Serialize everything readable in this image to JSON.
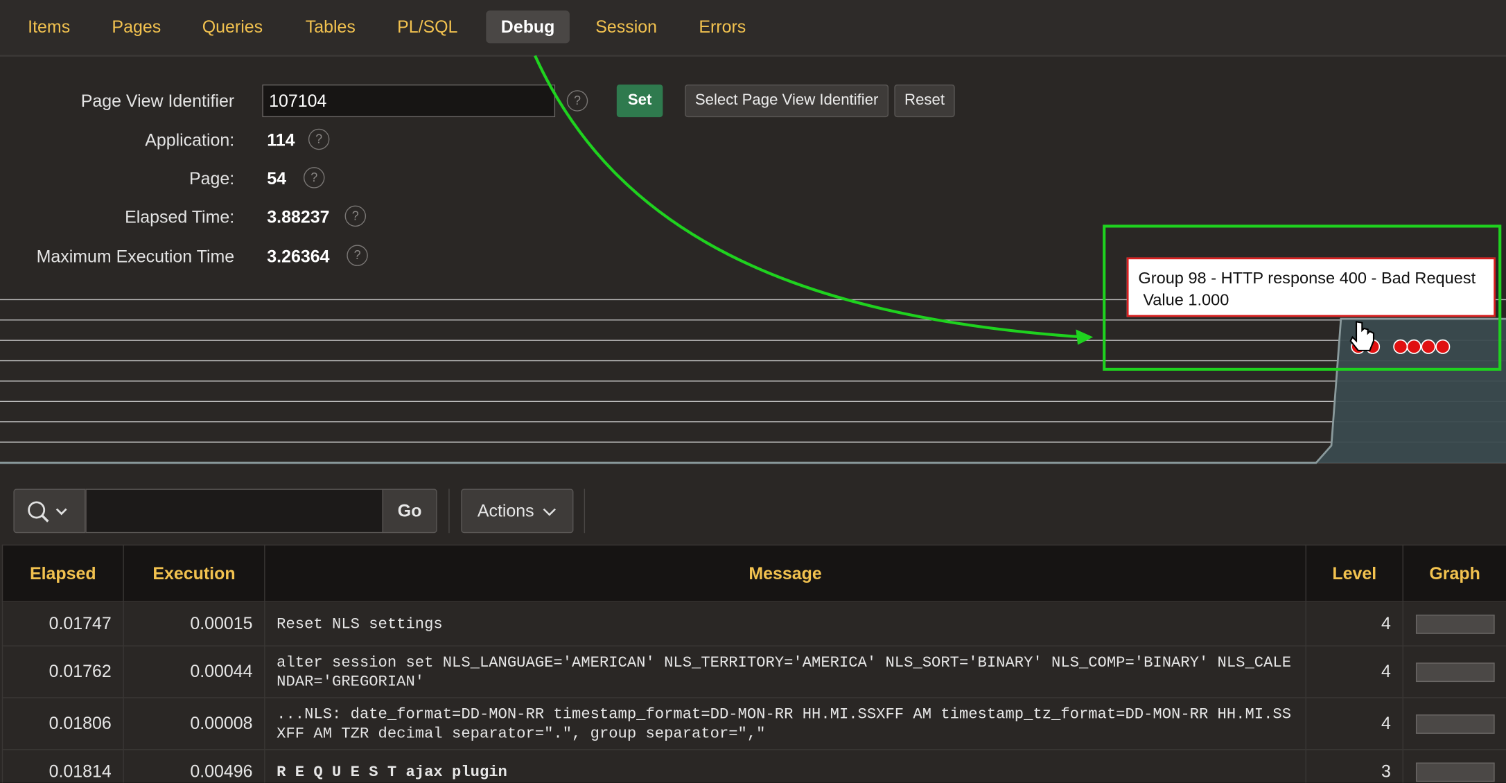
{
  "tabs": [
    {
      "label": "Items"
    },
    {
      "label": "Pages"
    },
    {
      "label": "Queries"
    },
    {
      "label": "Tables"
    },
    {
      "label": "PL/SQL"
    },
    {
      "label": "Debug",
      "active": true
    },
    {
      "label": "Session"
    },
    {
      "label": "Errors"
    }
  ],
  "form": {
    "page_view_identifier_label": "Page View Identifier",
    "page_view_identifier_value": "107104",
    "set_label": "Set",
    "select_pvi_label": "Select Page View Identifier",
    "reset_label": "Reset",
    "application_label": "Application:",
    "application_value": "114",
    "page_label": "Page:",
    "page_value": "54",
    "elapsed_label": "Elapsed Time:",
    "elapsed_value": "3.88237",
    "max_exec_label": "Maximum Execution Time",
    "max_exec_value": "3.26364",
    "help_glyph": "?"
  },
  "tooltip": {
    "line1": "Group 98 - HTTP response 400 - Bad Request",
    "line2": "Value 1.000"
  },
  "toolbar": {
    "go_label": "Go",
    "actions_label": "Actions",
    "search_value": ""
  },
  "table": {
    "headers": [
      "Elapsed",
      "Execution",
      "Message",
      "Level",
      "Graph"
    ],
    "rows": [
      {
        "elapsed": "0.01747",
        "execution": "0.00015",
        "message": "Reset NLS settings",
        "level": "4"
      },
      {
        "elapsed": "0.01762",
        "execution": "0.00044",
        "message": "alter session set  NLS_LANGUAGE='AMERICAN' NLS_TERRITORY='AMERICA' NLS_SORT='BINARY' NLS_COMP='BINARY' NLS_CALENDAR='GREGORIAN'",
        "level": "4"
      },
      {
        "elapsed": "0.01806",
        "execution": "0.00008",
        "message": "...NLS: date_format=DD-MON-RR timestamp_format=DD-MON-RR HH.MI.SSXFF AM timestamp_tz_format=DD-MON-RR HH.MI.SSXFF AM TZR decimal separator=\".\", group separator=\",\"",
        "level": "4"
      },
      {
        "elapsed": "0.01814",
        "execution": "0.00496",
        "message": "R E Q U E S T ajax plugin",
        "level": "3",
        "bold": true
      }
    ]
  },
  "colors": {
    "accent": "#f2c24f",
    "set_button": "#2f7a4e",
    "highlight": "#1fd21f",
    "marker": "#e01010"
  },
  "chart_data": {
    "type": "area",
    "ylim": [
      0,
      1
    ],
    "x": [
      0,
      1,
      2,
      3,
      4,
      5,
      6,
      7,
      8,
      9
    ],
    "values": [
      0,
      0,
      0,
      0,
      0,
      0,
      0,
      0,
      0.12,
      1.0
    ],
    "markers": [
      {
        "group": 98,
        "label": "Group 98 - HTTP response 400 - Bad Request",
        "value": 1.0
      }
    ]
  }
}
